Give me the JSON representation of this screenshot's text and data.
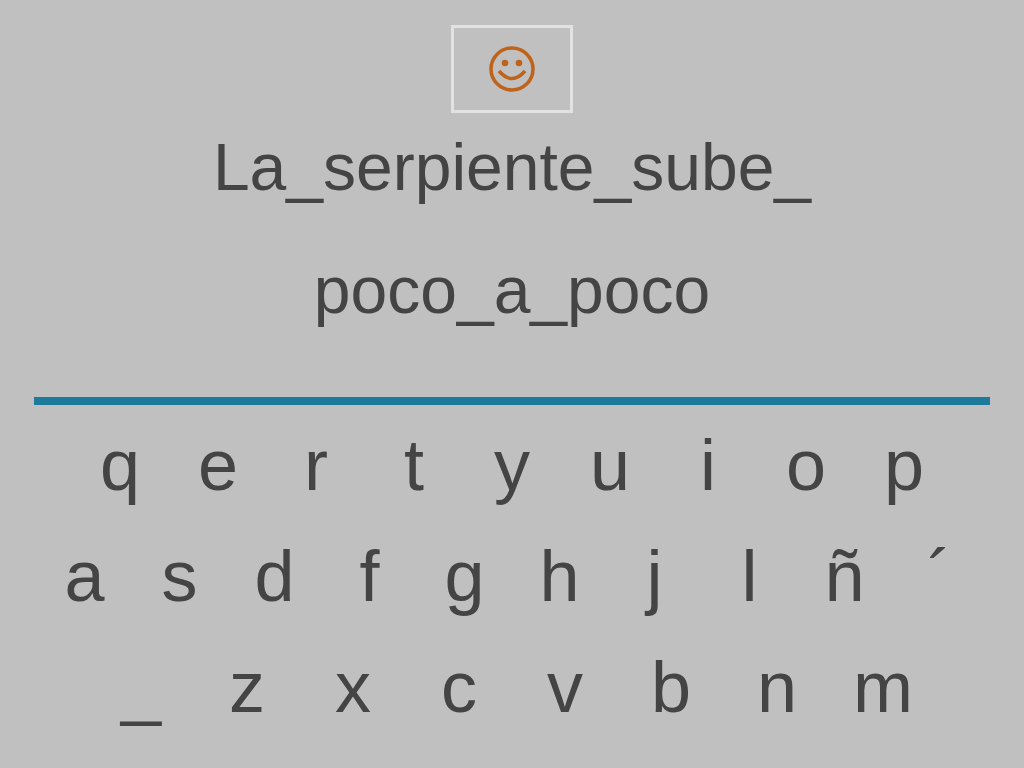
{
  "phrase_lines": [
    "La_serpiente_sube_",
    "poco_a_poco"
  ],
  "keyboard": {
    "rows": [
      [
        "q",
        "e",
        "r",
        "t",
        "y",
        "u",
        "i",
        "o",
        "p"
      ],
      [
        "a",
        "s",
        "d",
        "f",
        "g",
        "h",
        "j",
        "l",
        "ñ",
        "´"
      ],
      [
        "_",
        "z",
        "x",
        "c",
        "v",
        "b",
        "n",
        "m"
      ]
    ]
  }
}
